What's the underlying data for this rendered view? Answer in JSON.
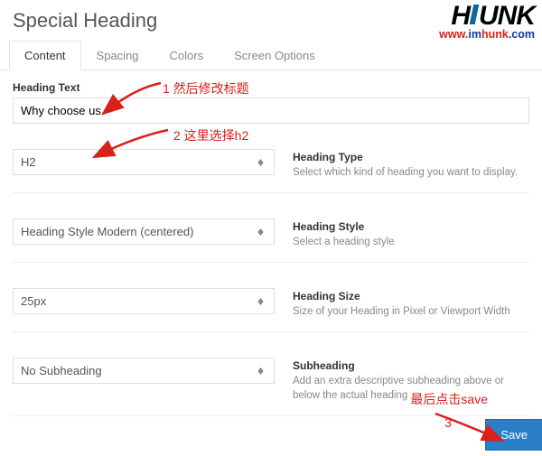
{
  "page": {
    "title": "Special Heading"
  },
  "tabs": {
    "content": "Content",
    "spacing": "Spacing",
    "colors": "Colors",
    "screen": "Screen Options"
  },
  "heading_text": {
    "label": "Heading Text",
    "value": "Why choose us"
  },
  "heading_type": {
    "value": "H2",
    "title": "Heading Type",
    "desc": "Select which kind of heading you want to display."
  },
  "heading_style": {
    "value": "Heading Style Modern (centered)",
    "title": "Heading Style",
    "desc": "Select a heading style"
  },
  "heading_size": {
    "value": "25px",
    "title": "Heading Size",
    "desc": "Size of your Heading in Pixel or Viewport Width"
  },
  "subheading": {
    "value": "No Subheading",
    "title": "Subheading",
    "desc": "Add an extra descriptive subheading above or below the actual heading"
  },
  "save": "Save",
  "anno": {
    "t1": "1 然后修改标题",
    "t2": "2 这里选择h2",
    "t3": "最后点击save",
    "t4": "3"
  },
  "logo": {
    "text_h": "H",
    "text_unk": "UNK",
    "url_www": "www.",
    "url_im": "im",
    "url_hunk": "hunk",
    "url_com": ".com"
  }
}
